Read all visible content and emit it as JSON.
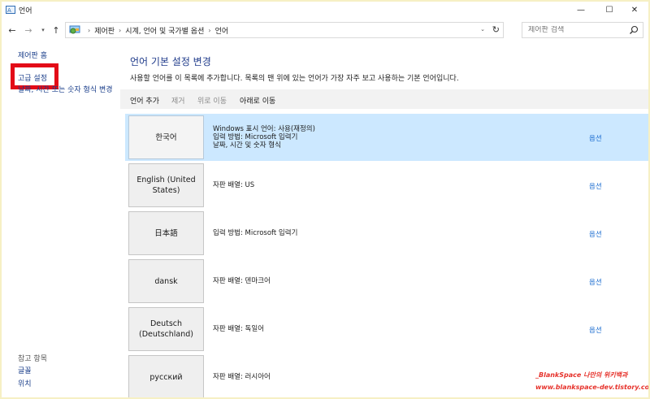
{
  "window": {
    "title": "언어",
    "minimize_label": "—",
    "maximize_label": "☐",
    "close_label": "✕"
  },
  "nav": {
    "back_glyph": "←",
    "forward_glyph": "→",
    "recent_glyph": "▾",
    "up_glyph": "↑",
    "breadcrumbs": [
      "제어판",
      "시계, 언어 및 국가별 옵션",
      "언어"
    ],
    "crumb_separator": "›",
    "address_dropdown_glyph": "⌄",
    "refresh_glyph": "↻",
    "search_placeholder": "제어판 검색"
  },
  "sidebar": {
    "home_link": "제어판 홈",
    "advanced_link": "고급 설정",
    "date_link": "날짜, 시간 또는 숫자 형식 변경",
    "see_also_heading": "참고 항목",
    "fonts_link": "글꼴",
    "location_link": "위치",
    "highlight_color": "#e30b17"
  },
  "main": {
    "title": "언어 기본 설정 변경",
    "description": "사용할 언어를 이 목록에 추가합니다. 목록의 맨 위에 있는 언어가 가장 자주 보고 사용하는 기본 언어입니다.",
    "toolbar": {
      "add": "언어 추가",
      "remove": "제거",
      "move_up": "위로 이동",
      "move_down": "아래로 이동"
    },
    "options_label": "옵션",
    "languages": [
      {
        "name": "한국어",
        "details": [
          "Windows 표시 언어: 사용(재정의)",
          "입력 방법: Microsoft 입력기",
          "날짜, 시간 및 숫자 형식"
        ],
        "selected": true
      },
      {
        "name": "English (United States)",
        "details": [
          "자판 배열: US"
        ],
        "selected": false
      },
      {
        "name": "日本語",
        "details": [
          "입력 방법: Microsoft 입력기"
        ],
        "selected": false
      },
      {
        "name": "dansk",
        "details": [
          "자판 배열: 덴마크어"
        ],
        "selected": false
      },
      {
        "name": "Deutsch (Deutschland)",
        "details": [
          "자판 배열: 독일어"
        ],
        "selected": false
      },
      {
        "name": "русский",
        "details": [
          "자판 배열: 러시아어"
        ],
        "selected": false
      }
    ]
  },
  "watermark": {
    "line1": "_BlankSpace 나만의 위키백과",
    "line2": "www.blankspace-dev.tistory.com",
    "color": "#e6322b"
  },
  "colors": {
    "selected_row": "#cce8ff",
    "link": "#1a3e8a",
    "title": "#1e3a8a",
    "option_link": "#1f6fd1"
  }
}
